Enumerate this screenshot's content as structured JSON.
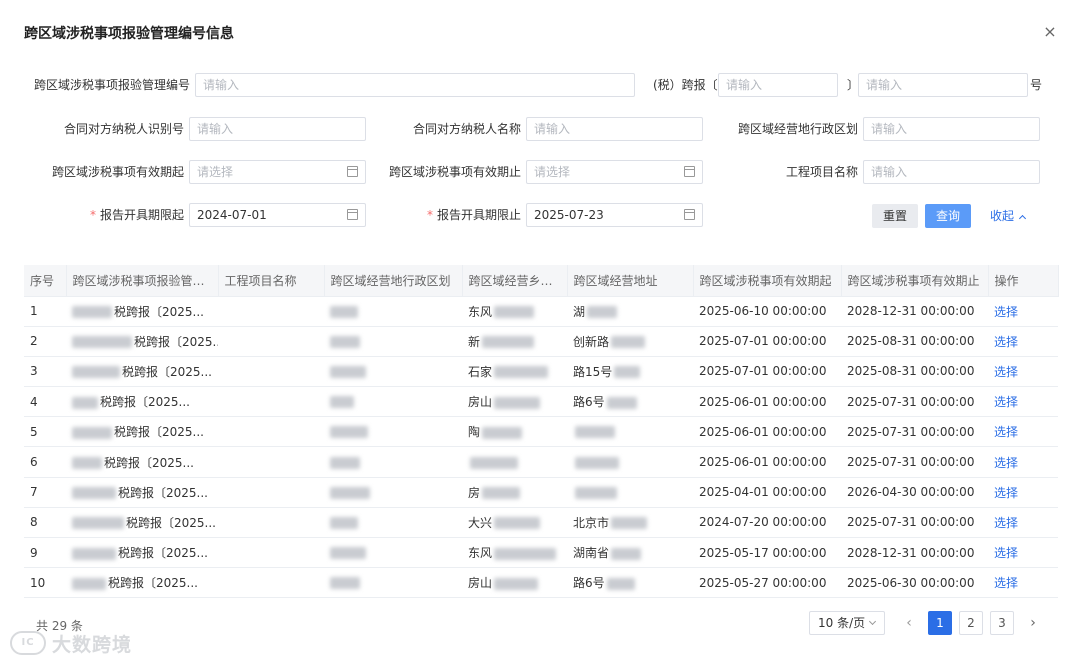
{
  "dialog": {
    "title": "跨区域涉税事项报验管理编号信息",
    "close_icon": "×"
  },
  "form": {
    "mgmt_no_label": "跨区域涉税事项报验管理编号",
    "mgmt_no_placeholder": "请输入",
    "tax_prefix": "(税）跨报〔",
    "year_placeholder": "请输入",
    "bracket_close": "〕",
    "seq_placeholder": "请输入",
    "suffix": "号",
    "counterparty_id_label": "合同对方纳税人识别号",
    "counterparty_id_placeholder": "请输入",
    "counterparty_name_label": "合同对方纳税人名称",
    "counterparty_name_placeholder": "请输入",
    "region_label": "跨区域经营地行政区划",
    "region_placeholder": "请输入",
    "valid_from_label": "跨区域涉税事项有效期起",
    "valid_from_placeholder": "请选择",
    "valid_to_label": "跨区域涉税事项有效期止",
    "valid_to_placeholder": "请选择",
    "project_label": "工程项目名称",
    "project_placeholder": "请输入",
    "required_mark": "*",
    "report_from_label": "报告开具期限起",
    "report_from_value": "2024-07-01",
    "report_to_label": "报告开具期限止",
    "report_to_value": "2025-07-23",
    "reset_label": "重置",
    "query_label": "查询",
    "collapse_label": "收起"
  },
  "table": {
    "columns": [
      "序号",
      "跨区域涉税事项报验管理编...",
      "工程项目名称",
      "跨区域经营地行政区划",
      "跨区域经营乡镇...",
      "跨区域经营地址",
      "跨区域涉税事项有效期起",
      "跨区域涉税事项有效期止",
      "操作"
    ],
    "rows": [
      {
        "no": "1",
        "mgmt": "税跨报〔2025...",
        "project": "",
        "region": "",
        "town": "东风",
        "addr": "湖",
        "start": "2025-06-10 00:00:00",
        "end": "2028-12-31 00:00:00",
        "op": "选择"
      },
      {
        "no": "2",
        "mgmt": "税跨报〔2025...",
        "project": "",
        "region": "",
        "town": "新",
        "addr": "创新路",
        "start": "2025-07-01 00:00:00",
        "end": "2025-08-31 00:00:00",
        "op": "选择"
      },
      {
        "no": "3",
        "mgmt": "税跨报〔2025...",
        "project": "",
        "region": "",
        "town": "石家",
        "addr": "路15号",
        "start": "2025-07-01 00:00:00",
        "end": "2025-08-31 00:00:00",
        "op": "选择"
      },
      {
        "no": "4",
        "mgmt": "税跨报〔2025...",
        "project": "",
        "region": "",
        "town": "房山",
        "addr": "路6号",
        "start": "2025-06-01 00:00:00",
        "end": "2025-07-31 00:00:00",
        "op": "选择"
      },
      {
        "no": "5",
        "mgmt": "税跨报〔2025...",
        "project": "",
        "region": "",
        "town": "陶",
        "addr": "",
        "start": "2025-06-01 00:00:00",
        "end": "2025-07-31 00:00:00",
        "op": "选择"
      },
      {
        "no": "6",
        "mgmt": "税跨报〔2025...",
        "project": "",
        "region": "",
        "town": "",
        "addr": "",
        "start": "2025-06-01 00:00:00",
        "end": "2025-07-31 00:00:00",
        "op": "选择"
      },
      {
        "no": "7",
        "mgmt": "税跨报〔2025...",
        "project": "",
        "region": "",
        "town": "房",
        "addr": "",
        "start": "2025-04-01 00:00:00",
        "end": "2026-04-30 00:00:00",
        "op": "选择"
      },
      {
        "no": "8",
        "mgmt": "税跨报〔2025...",
        "project": "",
        "region": "",
        "town": "大兴",
        "addr": "北京市",
        "start": "2024-07-20 00:00:00",
        "end": "2025-07-31 00:00:00",
        "op": "选择"
      },
      {
        "no": "9",
        "mgmt": "税跨报〔2025...",
        "project": "",
        "region": "",
        "town": "东风",
        "addr": "湖南省",
        "start": "2025-05-17 00:00:00",
        "end": "2028-12-31 00:00:00",
        "op": "选择"
      },
      {
        "no": "10",
        "mgmt": "税跨报〔2025...",
        "project": "",
        "region": "",
        "town": "房山",
        "addr": "路6号",
        "start": "2025-05-27 00:00:00",
        "end": "2025-06-30 00:00:00",
        "op": "选择"
      }
    ]
  },
  "pagination": {
    "total_text": "共 29 条",
    "page_size": "10 条/页",
    "prev_icon": "‹",
    "next_icon": "›",
    "pages": [
      "1",
      "2",
      "3"
    ],
    "current": "1"
  },
  "watermark": {
    "text": "大数跨境",
    "logo_text": "IC"
  }
}
